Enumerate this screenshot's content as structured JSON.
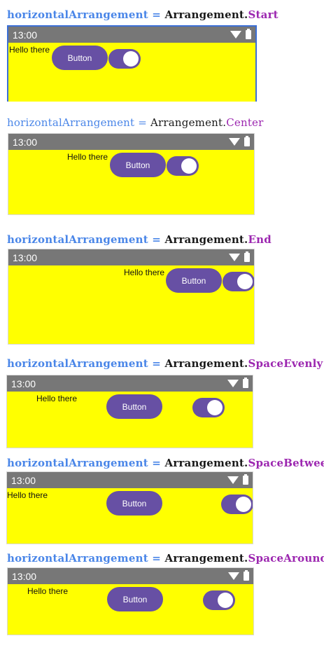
{
  "common": {
    "status_time": "13:00",
    "hello_text": "Hello there",
    "button_label": "Button",
    "property": "horizontalArrangement",
    "equals": "=",
    "class_prefix": "Arrangement."
  },
  "sections": [
    {
      "value": "Start",
      "switch_checked": true
    },
    {
      "value": "Center",
      "switch_checked": true
    },
    {
      "value": "End",
      "switch_checked": true
    },
    {
      "value": "SpaceEvenly",
      "switch_checked": true
    },
    {
      "value": "SpaceBetween",
      "switch_checked": true
    },
    {
      "value": "SpaceAround",
      "switch_checked": true
    }
  ],
  "colors": {
    "preview_background": "#ffff00",
    "status_bar": "#777777",
    "button": "#6750a4",
    "caption_property": "#4a86e8",
    "caption_value": "#9c27b0"
  }
}
